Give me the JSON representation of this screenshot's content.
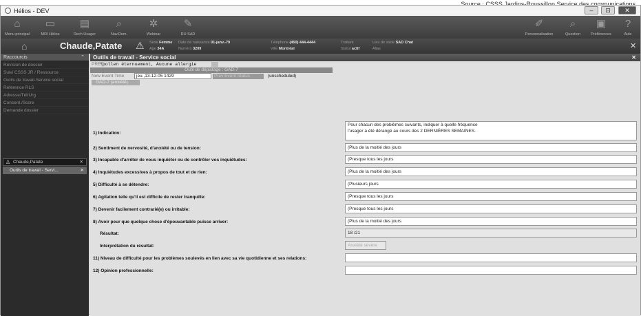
{
  "credit": "Source : CSSS Jardins-Roussillon Service des communications",
  "window": {
    "title": "Hélios - DEV",
    "controls": [
      "–",
      "⊡",
      "✕"
    ]
  },
  "toolbar": {
    "left": [
      {
        "icon": "house-icon",
        "glyph": "⌂",
        "label": "Menu principal"
      },
      {
        "icon": "monitor-icon",
        "glyph": "▭",
        "label": "MRI Hélios"
      },
      {
        "icon": "document-icon",
        "glyph": "▤",
        "label": "Rech Usager"
      },
      {
        "icon": "magnifier-icon",
        "glyph": "⌕",
        "label": "Nav.Dem."
      },
      {
        "icon": "gear-icon",
        "glyph": "✲",
        "label": "Webinar"
      },
      {
        "icon": "clipboard-icon",
        "glyph": "✎",
        "label": "RU SAD"
      }
    ],
    "right": [
      {
        "icon": "tools-icon",
        "glyph": "✐",
        "label": "Personnalisation"
      },
      {
        "icon": "search-icon",
        "glyph": "⌕",
        "label": "Question"
      },
      {
        "icon": "preferences-icon",
        "glyph": "▣",
        "label": "Préférences"
      },
      {
        "icon": "help-icon",
        "glyph": "?",
        "label": "Aide"
      }
    ]
  },
  "patient": {
    "name": "Chaude,Patate",
    "sexe_label": "Sexe",
    "sexe": "Femme",
    "age_label": "Age",
    "age": "34A",
    "ddn_label": "Date de naissance",
    "ddn": "01-janv.-79",
    "dossier_label": "Numéro",
    "dossier": "3209",
    "tel_label": "Téléphone",
    "tel": "(450) 444-4444",
    "ville_label": "Ville",
    "ville": "Montréal",
    "traitant_label": "Traitant",
    "statut_label": "Statut",
    "statut": "actif",
    "lieu_label": "Lieu de visite",
    "lieu": "SAD Chat",
    "alias_label": "Alias"
  },
  "sidebar": {
    "header": "Raccourcis",
    "items": [
      "Révision de dossier",
      "Suivi CSSS JR / Ressource",
      "Outils de travail-Service social",
      "Référence RLS",
      "Adresse/Tél/Urg",
      "Consent./Score",
      "Demande dossier"
    ],
    "patient_tab": "Chaude,Patate",
    "tool_tab": "Outils de travail - Servi..."
  },
  "panel": {
    "title": "Outils de travail - Service social",
    "prec_label": "PREC",
    "prec_value": "*pollen éternuement, Aucune allergie",
    "depistage": "Outil de dépistage : GAD-7",
    "event_label": "New Event Time",
    "event_value": "jeu.,13-12-05 1429",
    "prev_label": "Prev Event Status",
    "prev_value": "(unscheduled)",
    "gad_label": "GAD-7 (anxiété)"
  },
  "questions": [
    {
      "label": "1) Indication:",
      "value": "Pour chacun des problèmes suivants, indiquer à quelle fréquence\nl'usager a été dérangé au cours des 2 DERNIÈRES SEMAINES."
    },
    {
      "label": "2) Sentiment de nervosité, d'anxiété ou de tension:",
      "value": "(Plus de la moitié des jours"
    },
    {
      "label": "3) Incapable d'arrêter de vous inquiéter ou de contrôler vos inquiétudes:",
      "value": "(Presque tous les jours"
    },
    {
      "label": "4) Inquiétudes excessives à propos de tout et de rien:",
      "value": "(Plus de la moitié des jours"
    },
    {
      "label": "5) Difficulté à se détendre:",
      "value": "(Plusieurs jours"
    },
    {
      "label": "6) Agitation telle qu'il est difficile de rester tranquille:",
      "value": "(Presque tous les jours"
    },
    {
      "label": "7) Devenir facilement contrarié(e) ou irritable:",
      "value": "(Presque tous les jours"
    },
    {
      "label": "8) Avoir peur que quelque chose d'épouvantable puisse arriver:",
      "value": "(Plus de la moitié des jours"
    },
    {
      "label": "Résultat:",
      "value": "18 /21"
    },
    {
      "label": "Interprétation du résultat:",
      "value": "Anxiété sévère"
    },
    {
      "label": "11) Niveau de difficulté pour les problèmes soulevés en lien avec sa vie quotidienne et ses relations:",
      "value": ""
    },
    {
      "label": "12) Opinion professionnelle:",
      "value": ""
    }
  ]
}
